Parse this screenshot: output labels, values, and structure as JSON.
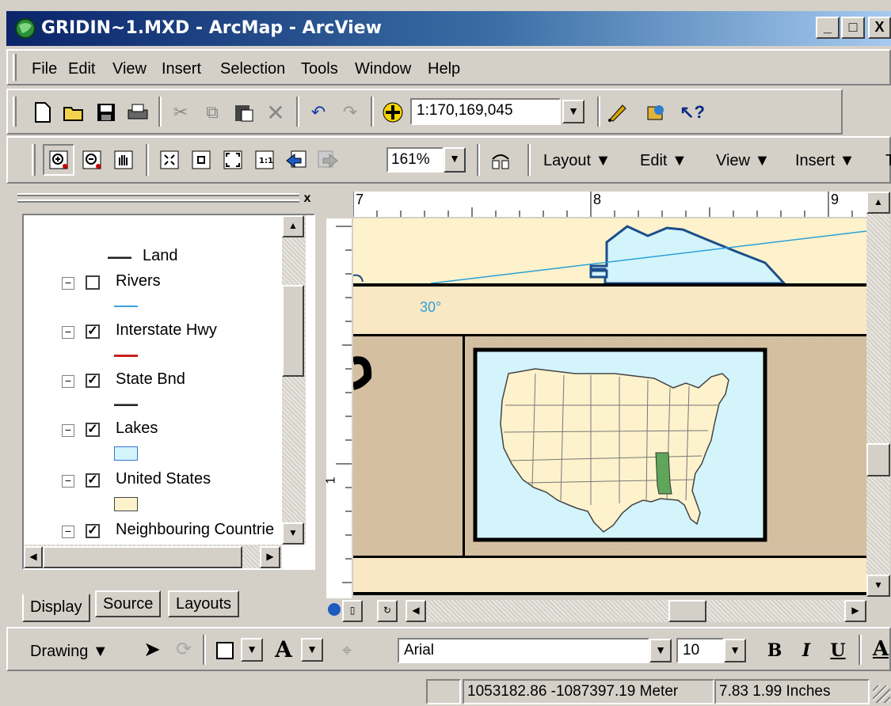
{
  "window": {
    "title": "GRIDIN~1.MXD - ArcMap - ArcView",
    "minimize": "_",
    "maximize": "□",
    "close": "X"
  },
  "menu": [
    "File",
    "Edit",
    "View",
    "Insert",
    "Selection",
    "Tools",
    "Window",
    "Help"
  ],
  "standard_toolbar": {
    "scale": "1:170,169,045"
  },
  "layout_toolbar": {
    "zoom": "161%",
    "menus": [
      "Layout ▼",
      "Edit ▼",
      "View ▼",
      "Insert ▼",
      "T"
    ]
  },
  "toc": {
    "close": "x",
    "layers": [
      {
        "name": "Land",
        "checked": null
      },
      {
        "name": "Rivers",
        "checked": false
      },
      {
        "name": "Interstate Hwy",
        "checked": true
      },
      {
        "name": "State Bnd",
        "checked": true
      },
      {
        "name": "Lakes",
        "checked": true
      },
      {
        "name": "United States",
        "checked": true
      },
      {
        "name": "Neighbouring Countrie",
        "checked": true
      }
    ],
    "tabs": [
      "Display",
      "Source",
      "Layouts"
    ]
  },
  "map": {
    "ruler_labels": [
      "7",
      "8",
      "9"
    ],
    "vruler_label": "1",
    "graticule_label": "30°",
    "colors": {
      "lake": "#d4f4fc",
      "land": "#fdf2cc",
      "neatline_bg": "#d4bfa0",
      "highlight_state": "#5fa55a"
    }
  },
  "drawing_toolbar": {
    "drawing_label": "Drawing ▼",
    "font": "Arial",
    "size": "10",
    "bold": "B",
    "italic": "I",
    "underline": "U",
    "color_a": "A"
  },
  "status": {
    "coords": "1053182.86  -1087397.19 Meter",
    "page": "7.83  1.99 Inches"
  }
}
